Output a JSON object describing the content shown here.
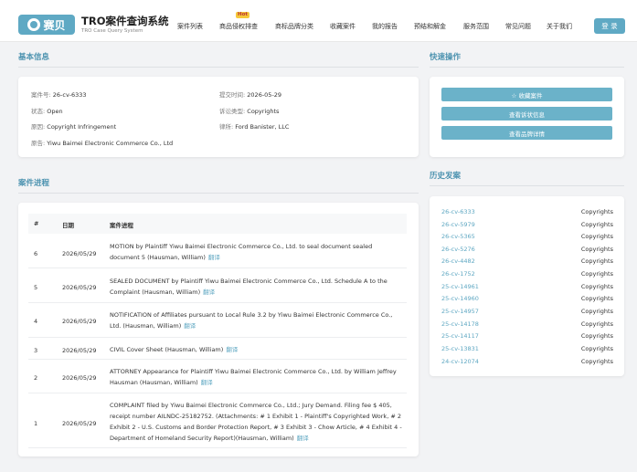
{
  "nav": {
    "logo_text": "赛贝",
    "brand_title": "TRO案件查询系统",
    "brand_sub": "TRO Case Query System",
    "links": [
      "案件列表",
      "商品侵权排查",
      "商标品牌分类",
      "收藏案件",
      "我的报告",
      "预结和解金",
      "服务范围",
      "常见问题",
      "关于我们"
    ],
    "hot_badge": "Hot",
    "login": "登 录"
  },
  "basic": {
    "title": "基本信息",
    "case_no_label": "案件号:",
    "case_no": "26-cv-6333",
    "filed_label": "提交时间:",
    "filed": "2026-05-29",
    "status_label": "状态:",
    "status": "Open",
    "type_label": "诉讼类型:",
    "type": "Copyrights",
    "cause_label": "原因:",
    "cause": "Copyright Infringement",
    "lawyer_label": "律所:",
    "lawyer": "Ford Banister, LLC",
    "plaintiff_label": "原告:",
    "plaintiff": "Yiwu Baimei Electronic Commerce Co., Ltd"
  },
  "quick": {
    "title": "快速操作",
    "buttons": [
      "☆ 收藏案件",
      "查看诉状信息",
      "查看品牌详情"
    ]
  },
  "history": {
    "title": "历史发案",
    "rows": [
      {
        "num": "26-cv-6333",
        "type": "Copyrights"
      },
      {
        "num": "26-cv-5979",
        "type": "Copyrights"
      },
      {
        "num": "26-cv-5365",
        "type": "Copyrights"
      },
      {
        "num": "26-cv-5276",
        "type": "Copyrights"
      },
      {
        "num": "26-cv-4482",
        "type": "Copyrights"
      },
      {
        "num": "26-cv-1752",
        "type": "Copyrights"
      },
      {
        "num": "25-cv-14961",
        "type": "Copyrights"
      },
      {
        "num": "25-cv-14960",
        "type": "Copyrights"
      },
      {
        "num": "25-cv-14957",
        "type": "Copyrights"
      },
      {
        "num": "25-cv-14178",
        "type": "Copyrights"
      },
      {
        "num": "25-cv-14117",
        "type": "Copyrights"
      },
      {
        "num": "25-cv-13831",
        "type": "Copyrights"
      },
      {
        "num": "24-cv-12074",
        "type": "Copyrights"
      }
    ]
  },
  "progress": {
    "title": "案件进程",
    "headers": [
      "#",
      "日期",
      "案件进程"
    ],
    "translate_label": "翻译",
    "rows": [
      {
        "idx": "6",
        "date": "2026/05/29",
        "text": "MOTION by Plaintiff Yiwu Baimei Electronic Commerce Co., Ltd. to seal document sealed document 5 (Hausman, William)"
      },
      {
        "idx": "5",
        "date": "2026/05/29",
        "text": "SEALED DOCUMENT by Plaintiff Yiwu Baimei Electronic Commerce Co., Ltd. Schedule A to the Complaint (Hausman, William)"
      },
      {
        "idx": "4",
        "date": "2026/05/29",
        "text": "NOTIFICATION of Affiliates pursuant to Local Rule 3.2 by Yiwu Baimei Electronic Commerce Co., Ltd. (Hausman, William)"
      },
      {
        "idx": "3",
        "date": "2026/05/29",
        "text": "CIVIL Cover Sheet (Hausman, William)"
      },
      {
        "idx": "2",
        "date": "2026/05/29",
        "text": "ATTORNEY Appearance for Plaintiff Yiwu Baimei Electronic Commerce Co., Ltd. by William Jeffrey Hausman (Hausman, William)"
      },
      {
        "idx": "1",
        "date": "2026/05/29",
        "text": "COMPLAINT filed by Yiwu Baimei Electronic Commerce Co., Ltd.; Jury Demand. Filing fee $ 405, receipt number AILNDC-25182752. (Attachments: # 1 Exhibit 1 - Plaintiff's Copyrighted Work, # 2 Exhibit 2 - U.S. Customs and Border Protection Report, # 3 Exhibit 3 - Chow Article, # 4 Exhibit 4 - Department of Homeland Security Report)(Hausman, William)"
      }
    ]
  }
}
